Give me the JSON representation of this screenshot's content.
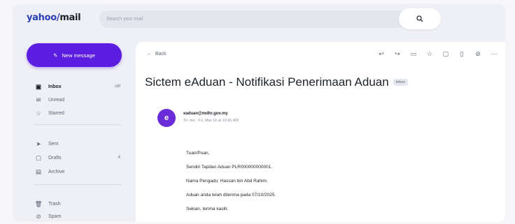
{
  "app": {
    "logo_main": "yahoo/",
    "logo_suffix": "mail",
    "search_placeholder": "Search your mail",
    "search_adv_icon": "filter-icon",
    "search_button_icon": "search-icon"
  },
  "sidebar": {
    "compose_label": "New message",
    "items": [
      {
        "label": "Inbox",
        "icon": "inbox-icon",
        "count": "cdt",
        "active": true
      },
      {
        "label": "Unread",
        "icon": "unread-icon",
        "count": "",
        "active": false
      },
      {
        "label": "Starred",
        "icon": "star-icon",
        "count": "",
        "active": false
      },
      {
        "label": "Sent",
        "icon": "sent-icon",
        "count": "",
        "active": false
      },
      {
        "label": "Drafts",
        "icon": "draft-icon",
        "count": "4",
        "active": false
      },
      {
        "label": "Archive",
        "icon": "archive-icon",
        "count": "",
        "active": false
      },
      {
        "label": "Trash",
        "icon": "trash-icon",
        "count": "",
        "active": false
      },
      {
        "label": "Spam",
        "icon": "spam-icon",
        "count": "",
        "active": false
      }
    ]
  },
  "message": {
    "back_label": "Back",
    "subject": "Sictem eAduan - Notifikasi Penerimaan Aduan",
    "badge": "Inbox",
    "avatar_letter": "e",
    "sender": "eaduan@mdhr.gov.my",
    "recipients": "To: me · Fri, Mar 14 at 10:41 AM",
    "body": [
      "Tuan/Puan,",
      "Sendiri Tapdan Aduan PLR000000000001.",
      "Nama Pengadu: Hassan bin Abd Rahim.",
      "Aduan anda telah diterima pada 07/10/2025.",
      "Sekian, terima kasih."
    ]
  },
  "toolbar": {
    "icons": [
      "reply-all-icon",
      "forward-icon",
      "archive-icon",
      "star-icon",
      "move-icon",
      "delete-icon",
      "spam-icon",
      "more-icon"
    ]
  },
  "colors": {
    "accent": "#5b1ee0",
    "logo": "#2a3fb8"
  }
}
